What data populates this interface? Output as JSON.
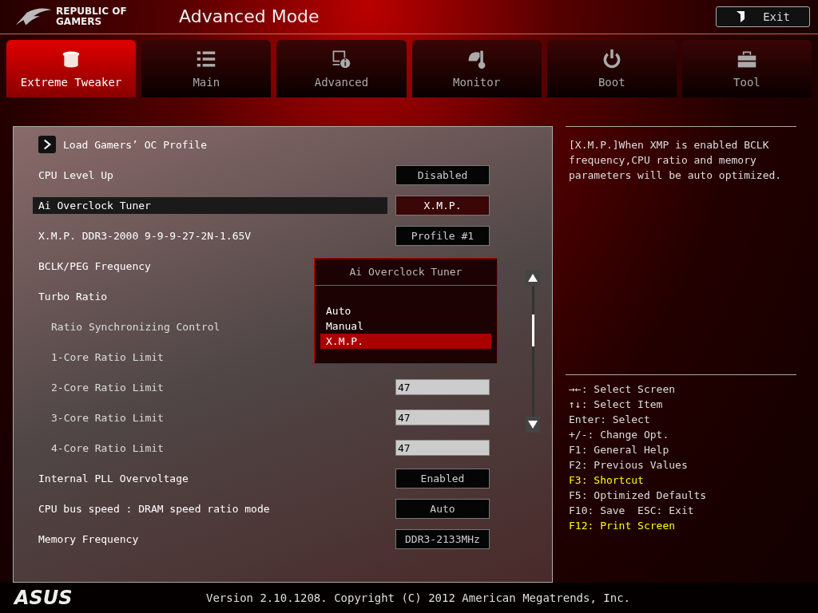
{
  "header": {
    "logo_text": [
      "REPUBLIC OF",
      "GAMERS"
    ],
    "title": "Advanced Mode",
    "exit_button": "Exit"
  },
  "tabs": [
    {
      "label": "Extreme Tweaker",
      "kind": "tweaker",
      "selected": true
    },
    {
      "label": "Main",
      "kind": "list",
      "selected": false
    },
    {
      "label": "Advanced",
      "kind": "advanced",
      "selected": false
    },
    {
      "label": "Monitor",
      "kind": "monitor",
      "selected": false
    },
    {
      "label": "Boot",
      "kind": "power",
      "selected": false
    },
    {
      "label": "Tool",
      "kind": "toolbox",
      "selected": false
    }
  ],
  "settings": [
    {
      "kind": "link",
      "label": "Load Gamers’ OC Profile",
      "selected": false
    },
    {
      "kind": "option",
      "label": "CPU Level Up",
      "value": "Disabled",
      "selected": false
    },
    {
      "kind": "option",
      "label": "Ai Overclock Tuner",
      "value": "X.M.P.",
      "selected": true
    },
    {
      "kind": "option",
      "label": "X.M.P. DDR3-2000 9-9-9-27-2N-1.65V",
      "value": "Profile #1",
      "selected": false
    },
    {
      "kind": "heading",
      "label": "BCLK/PEG Frequency",
      "selected": false
    },
    {
      "kind": "heading",
      "label": "Turbo Ratio",
      "selected": false,
      "children": [
        {
          "kind": "heading",
          "label": "Ratio Synchronizing Control",
          "selected": false
        },
        {
          "kind": "heading",
          "label": "1-Core Ratio Limit",
          "selected": false
        },
        {
          "kind": "field",
          "label": "2-Core Ratio Limit",
          "value": "47",
          "selected": false
        },
        {
          "kind": "field",
          "label": "3-Core Ratio Limit",
          "value": "47",
          "selected": false
        },
        {
          "kind": "field",
          "label": "4-Core Ratio Limit",
          "value": "47",
          "selected": false
        }
      ]
    },
    {
      "kind": "option",
      "label": "Internal PLL Overvoltage",
      "value": "Enabled",
      "selected": false
    },
    {
      "kind": "option",
      "label": "CPU bus speed : DRAM speed ratio mode",
      "value": "Auto",
      "selected": false
    },
    {
      "kind": "option",
      "label": "Memory Frequency",
      "value": "DDR3-2133MHz",
      "selected": false
    }
  ],
  "popup": {
    "title": "Ai Overclock Tuner",
    "options": [
      {
        "label": "Auto",
        "selected": false
      },
      {
        "label": "Manual",
        "selected": false
      },
      {
        "label": "X.M.P.",
        "selected": true
      }
    ]
  },
  "help_text": "[X.M.P.]When XMP is enabled BCLK frequency,CPU ratio and memory parameters will be auto optimized.",
  "key_hints": [
    {
      "text": "→←: Select Screen",
      "highlight": false
    },
    {
      "text": "↑↓: Select Item",
      "highlight": false
    },
    {
      "text": "Enter: Select",
      "highlight": false
    },
    {
      "text": "+/-: Change Opt.",
      "highlight": false
    },
    {
      "text": "F1: General Help",
      "highlight": false
    },
    {
      "text": "F2: Previous Values",
      "highlight": false
    },
    {
      "text": "F3: Shortcut",
      "highlight": true
    },
    {
      "text": "F5: Optimized Defaults",
      "highlight": false
    },
    {
      "text": "F10: Save  ESC: Exit",
      "highlight": false
    },
    {
      "text": "F12: Print Screen",
      "highlight": true
    }
  ],
  "footer": {
    "brand": "ASUS",
    "version": "Version 2.10.1208. Copyright (C) 2012 American Megatrends, Inc."
  }
}
